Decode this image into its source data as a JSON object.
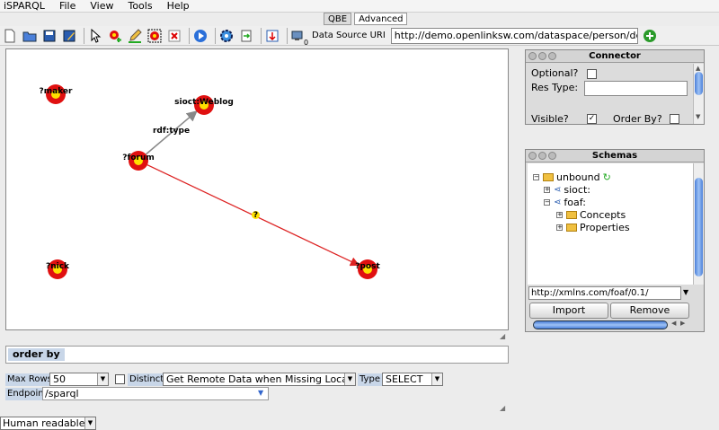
{
  "menu": {
    "app": "iSPARQL",
    "items": [
      "File",
      "View",
      "Tools",
      "Help"
    ]
  },
  "mode_tabs": {
    "qbe": "QBE",
    "advanced": "Advanced"
  },
  "toolbar": {
    "icons": [
      "new-doc-icon",
      "open-folder-icon",
      "save-icon",
      "save-as-icon",
      "pointer-icon",
      "add-node-icon",
      "pencil-icon",
      "group-icon",
      "delete-icon",
      "run-icon",
      "gear-icon",
      "export-icon",
      "load-icon",
      "datasource-icon"
    ],
    "ds_count": "0",
    "ds_label": "Data Source URI",
    "ds_value": "http://demo.openlinksw.com/dataspace/person/dem"
  },
  "graph": {
    "nodes": [
      {
        "id": "maker",
        "label": "?maker"
      },
      {
        "id": "weblog",
        "label": "sioct:Weblog"
      },
      {
        "id": "forum",
        "label": "?forum"
      },
      {
        "id": "nick",
        "label": "?nick"
      },
      {
        "id": "post",
        "label": "?post"
      }
    ],
    "edges": [
      {
        "from": "forum",
        "to": "weblog",
        "label": "rdf:type",
        "color": "#888888"
      },
      {
        "from": "forum",
        "to": "post",
        "label": "?",
        "color": "#dd2222"
      }
    ],
    "node_color": "#e01010",
    "node_center_color": "#ffe000"
  },
  "order_by": {
    "label": "order by"
  },
  "controls": {
    "max_rows_label": "Max Rows",
    "max_rows_value": "50",
    "distinct_label": "Distinct",
    "remote_value": "Get Remote Data when Missing Locally",
    "type_label": "Type",
    "type_value": "SELECT",
    "endpoint_label": "Endpoint",
    "endpoint_value": "/sparql",
    "output_value": "Human readable"
  },
  "connector": {
    "title": "Connector",
    "optional_label": "Optional?",
    "res_type_label": "Res Type:",
    "visible_label": "Visible?",
    "order_by_label": "Order By?",
    "visible_checked": "✓"
  },
  "schemas": {
    "title": "Schemas",
    "items": {
      "unbound": "unbound",
      "sioct": "sioct:",
      "foaf": "foaf:",
      "concepts": "Concepts",
      "properties": "Properties"
    },
    "uri_value": "http://xmlns.com/foaf/0.1/",
    "import_label": "Import",
    "remove_label": "Remove"
  }
}
